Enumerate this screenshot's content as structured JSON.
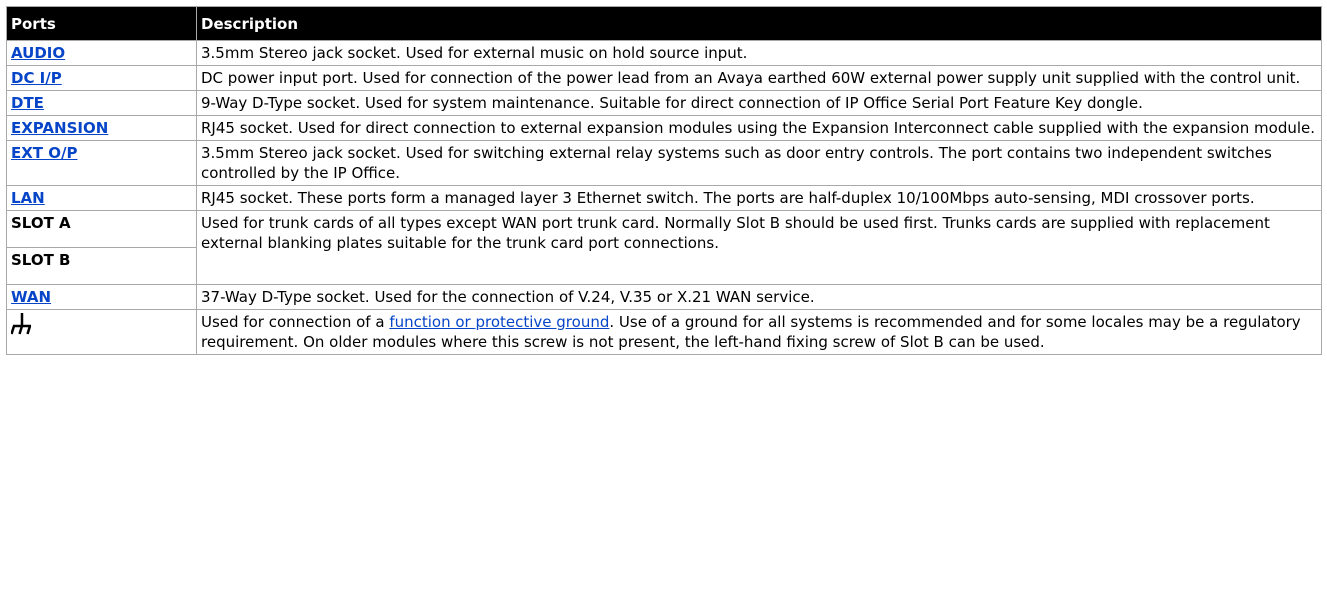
{
  "headers": {
    "ports": "Ports",
    "description": "Description"
  },
  "rows": [
    {
      "port": "AUDIO",
      "desc": "3.5mm Stereo jack socket. Used for external music on hold source input."
    },
    {
      "port": "DC I/P",
      "desc": "DC power input port. Used for connection of the power lead from an Avaya earthed 60W external power supply unit supplied with the control unit."
    },
    {
      "port": "DTE",
      "desc": "9-Way D-Type socket. Used for system maintenance. Suitable for direct connection of IP Office Serial Port Feature Key dongle."
    },
    {
      "port": "EXPANSION",
      "desc": "RJ45 socket. Used for direct connection to external expansion modules using the Expansion Interconnect cable supplied with the expansion module."
    },
    {
      "port": "EXT O/P",
      "desc": "3.5mm Stereo jack socket. Used for switching external relay systems such as door entry controls. The port contains two independent switches controlled by the IP Office."
    },
    {
      "port": "LAN",
      "desc": "RJ45 socket. These ports form a managed layer 3 Ethernet switch. The ports are half-duplex 10/100Mbps auto-sensing, MDI crossover ports."
    }
  ],
  "slots": {
    "a": "SLOT A",
    "b": "SLOT B",
    "desc": "Used for trunk cards of all types except WAN port trunk card. Normally Slot B should be used first. Trunks cards are supplied with replacement external blanking plates suitable for the trunk card port connections."
  },
  "wan": {
    "port": "WAN",
    "desc": "37-Way D-Type socket. Used for the connection of V.24, V.35 or X.21 WAN service."
  },
  "ground": {
    "icon": "ground-icon",
    "desc_before": "Used for connection of a ",
    "link": "function or protective ground",
    "desc_after": ". Use of a ground for all systems is recommended and for some locales may be a regulatory requirement. On older modules where this screw is not present, the left-hand fixing screw of Slot B can be used."
  },
  "colors": {
    "header_bg": "#000000",
    "link": "#0645c8",
    "border": "#a8a8a8"
  }
}
